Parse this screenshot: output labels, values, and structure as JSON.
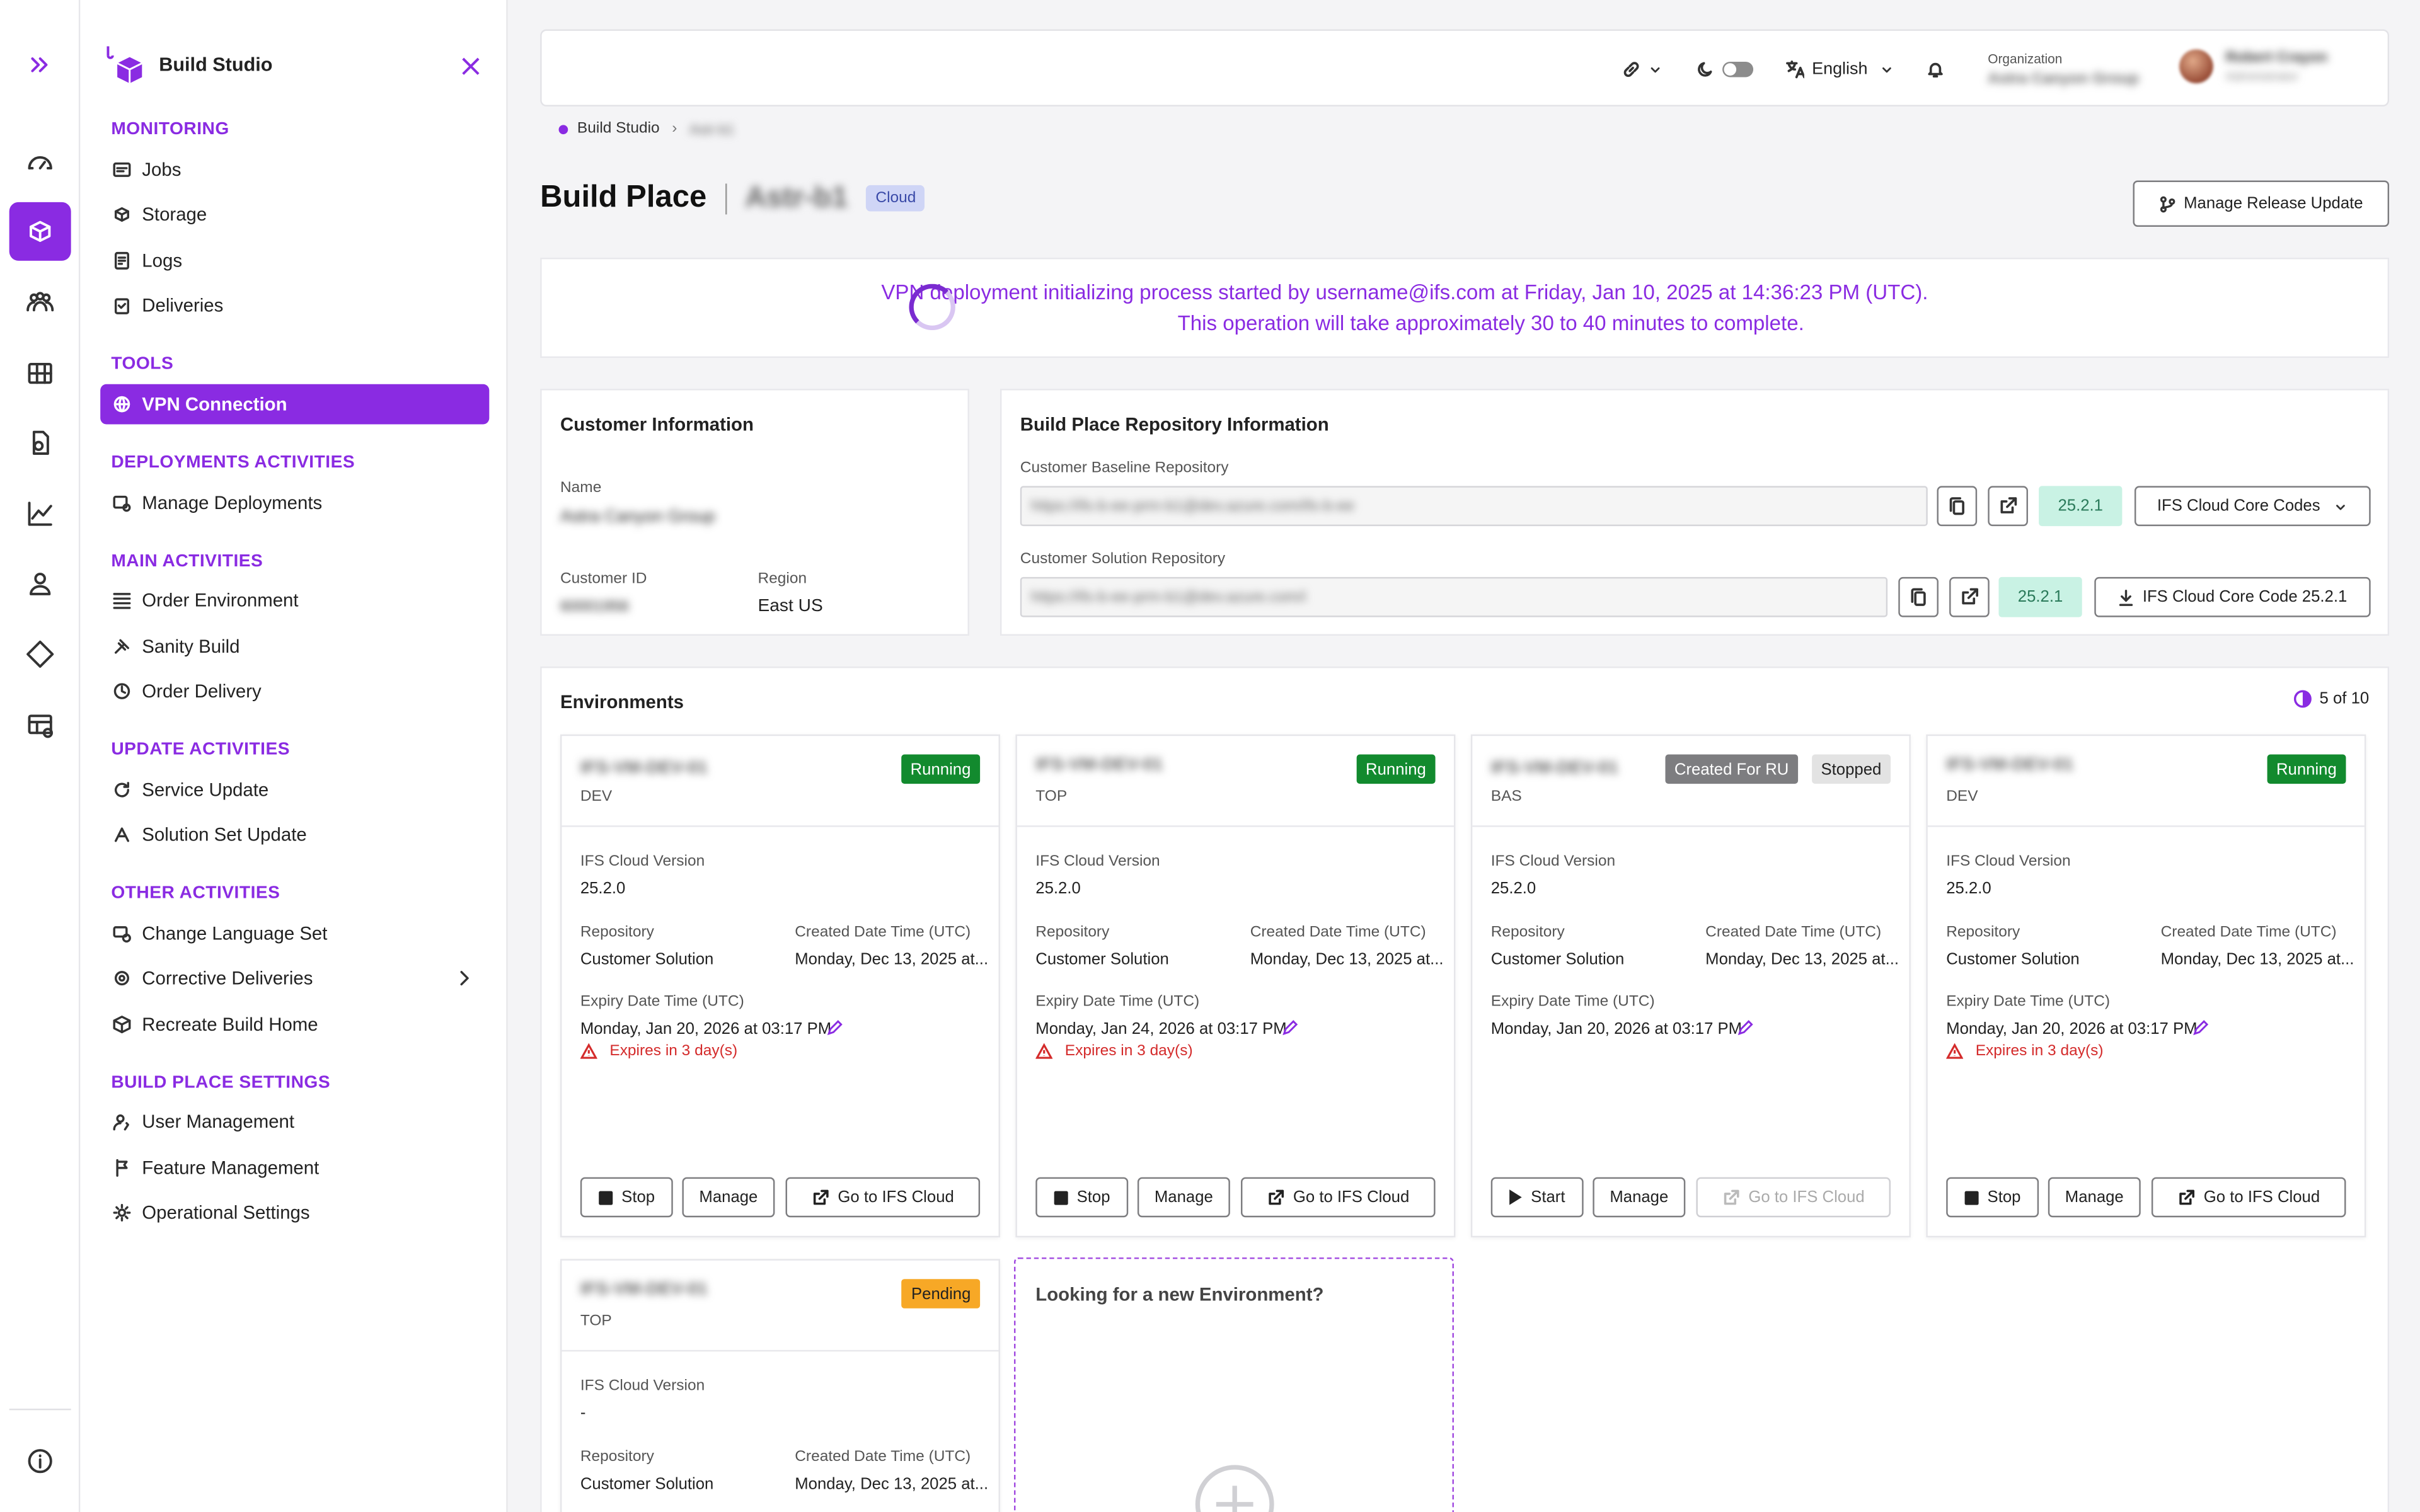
{
  "app": {
    "title": "Build Studio"
  },
  "sidebar": {
    "sections": {
      "monitoring": "MONITORING",
      "tools": "TOOLS",
      "deployments": "DEPLOYMENTS ACTIVITIES",
      "main": "MAIN ACTIVITIES",
      "update": "UPDATE ACTIVITIES",
      "other": "OTHER ACTIVITIES",
      "settings": "BUILD PLACE SETTINGS"
    },
    "items": {
      "jobs": "Jobs",
      "storage": "Storage",
      "logs": "Logs",
      "deliveries": "Deliveries",
      "vpn": "VPN Connection",
      "manage_deployments": "Manage Deployments",
      "order_environment": "Order Environment",
      "sanity_build": "Sanity Build",
      "order_delivery": "Order Delivery",
      "service_update": "Service Update",
      "solution_set_update": "Solution Set Update",
      "change_language_set": "Change Language Set",
      "corrective_deliveries": "Corrective Deliveries",
      "recreate_build_home": "Recreate Build Home",
      "user_management": "User Management",
      "feature_management": "Feature Management",
      "operational_settings": "Operational Settings"
    }
  },
  "topbar": {
    "language": "English",
    "org_label": "Organization",
    "org_name": "Astra Canyon Group",
    "user_name": "Robert Crayon",
    "user_role": "Administrator"
  },
  "breadcrumb": {
    "root": "Build Studio",
    "current": "Astr-b1"
  },
  "header": {
    "title": "Build Place",
    "name": "Astr-b1",
    "badge": "Cloud",
    "release_button": "Manage Release Update"
  },
  "vpn_banner": {
    "line1": "VPN deployment initializing process started by username@ifs.com at Friday, Jan 10, 2025 at 14:36:23 PM (UTC).",
    "line2": "This operation will take approximately 30 to 40 minutes to complete."
  },
  "customer": {
    "title": "Customer Information",
    "name_label": "Name",
    "name": "Astra Canyon Group",
    "id_label": "Customer ID",
    "id": "60001956",
    "region_label": "Region",
    "region": "East US"
  },
  "repo": {
    "title": "Build Place Repository Information",
    "baseline_label": "Customer Baseline Repository",
    "baseline_url": "https://ifs-b-ee-prm-b1@dev.azure.com/ifs-b-ee",
    "baseline_version": "25.2.1",
    "baseline_button": "IFS Cloud Core Codes",
    "solution_label": "Customer Solution Repository",
    "solution_url": "https://ifs-b-ee-prm-b1@dev.azure.com/i",
    "solution_version": "25.2.1",
    "solution_button": "IFS Cloud Core Code 25.2.1"
  },
  "environments": {
    "title": "Environments",
    "count": "5 of 10",
    "labels": {
      "version": "IFS Cloud Version",
      "repository": "Repository",
      "created": "Created Date Time (UTC)",
      "expiry": "Expiry Date Time (UTC)",
      "manage": "Manage",
      "goto": "Go to IFS Cloud"
    },
    "cards": [
      {
        "name": "IFS-VM-DEV-01",
        "type": "DEV",
        "status": "Running",
        "version": "25.2.0",
        "repository": "Customer Solution",
        "created": "Monday, Dec 13, 2025 at...",
        "expiry": "Monday, Jan 20, 2026 at 03:17 PM",
        "warning": "Expires in 3 day(s)",
        "action": "Stop"
      },
      {
        "name": "IFS-VM-DEV-01",
        "type": "TOP",
        "status": "Running",
        "version": "25.2.0",
        "repository": "Customer Solution",
        "created": "Monday, Dec 13, 2025 at...",
        "expiry": "Monday, Jan 24, 2026 at 03:17 PM",
        "warning": "Expires in 3 day(s)",
        "action": "Stop"
      },
      {
        "name": "IFS-VM-DEV-01",
        "type": "BAS",
        "status": "Stopped",
        "status2": "Created For RU",
        "version": "25.2.0",
        "repository": "Customer Solution",
        "created": "Monday, Dec 13, 2025 at...",
        "expiry": "Monday, Jan 20, 2026 at 03:17 PM",
        "warning": "",
        "action": "Start"
      },
      {
        "name": "IFS-VM-DEV-01",
        "type": "DEV",
        "status": "Running",
        "version": "25.2.0",
        "repository": "Customer Solution",
        "created": "Monday, Dec 13, 2025 at...",
        "expiry": "Monday, Jan 20, 2026 at 03:17 PM",
        "warning": "Expires in 3 day(s)",
        "action": "Stop"
      },
      {
        "name": "IFS-VM-DEV-01",
        "type": "TOP",
        "status": "Pending",
        "version": "-",
        "repository": "Customer Solution",
        "created": "Monday, Dec 13, 2025 at..."
      }
    ],
    "new_env_prompt": "Looking for a new Environment?"
  },
  "colors": {
    "accent": "#8a2be2",
    "running": "#128a2e",
    "pending": "#f7a826",
    "version_bg": "#c9f2e4",
    "error": "#d42b2b"
  }
}
